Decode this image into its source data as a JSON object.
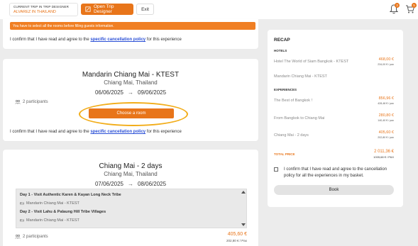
{
  "topbar": {
    "trip_label": "CURRENT TRIP IN TRIP DESIGNER",
    "trip_value": "ALVAREZ IN THAILAND",
    "open_trip_designer": "Open Trip Designer",
    "exit": "Exit",
    "notifications_count": "3",
    "cart_count": "5"
  },
  "warning": "You have to select all the rooms before filling guests information.",
  "confirm": {
    "prefix": "I confirm that I have read and agree to the",
    "link": "specific cancellation policy",
    "suffix": "for this experience"
  },
  "hotel_card": {
    "title": "Mandarin Chiang Mai - KTEST",
    "location": "Chiang Mai, Thailand",
    "date_from": "06/06/2025",
    "date_to": "09/06/2025",
    "participants": "2 participants",
    "choose_room": "Choose a room"
  },
  "tour_card": {
    "title": "Chiang Mai - 2 days",
    "location": "Chiang Mai, Thailand",
    "date_from": "07/06/2025",
    "date_to": "08/06/2025",
    "steps": [
      {
        "day": "Day 1 - Visit Authentic Karen & Kayan Long Neck Tribe",
        "hotel": "Mandarin Chiang Mai - KTEST"
      },
      {
        "day": "Day 2 - Visit Lahu & Palaung Hill Tribe Villages",
        "hotel": "Mandarin Chiang Mai - KTEST"
      }
    ],
    "participants": "2 participants",
    "price": "405,60 €",
    "price_per_pax": "202,80 € / Pax"
  },
  "recap": {
    "title": "RECAP",
    "hotels_label": "HOTELS",
    "hotels": [
      {
        "name": "Hotel The World of Siam Bangkok - KTEST",
        "price": "468,00 €",
        "sub": "234,00 € / pax"
      },
      {
        "name": "Mandarin Chiang Mai - KTEST",
        "price": "",
        "sub": ""
      }
    ],
    "experiences_label": "EXPERIENCES",
    "experiences": [
      {
        "name": "The Best of Bangkok !",
        "price": "856,96 €",
        "sub": "428,48 € / pax"
      },
      {
        "name": "From Bangkok to Chiang Mai",
        "price": "280,80 €",
        "sub": "140,40 € / pax"
      },
      {
        "name": "Chiang Mai - 2 days",
        "price": "405,60 €",
        "sub": "202,80 € / pax"
      }
    ],
    "total_label": "TOTAL PRICE",
    "total_price": "2 011,36 €",
    "total_sub": "1005,68 € / PAX",
    "agree_text": "I confirm that I have read and agree to the cancellation policy for all the experiences in my basket.",
    "book": "Book"
  },
  "colors": {
    "accent": "#e8751a",
    "link": "#2a4fd6",
    "highlight": "#f2ad1a"
  }
}
